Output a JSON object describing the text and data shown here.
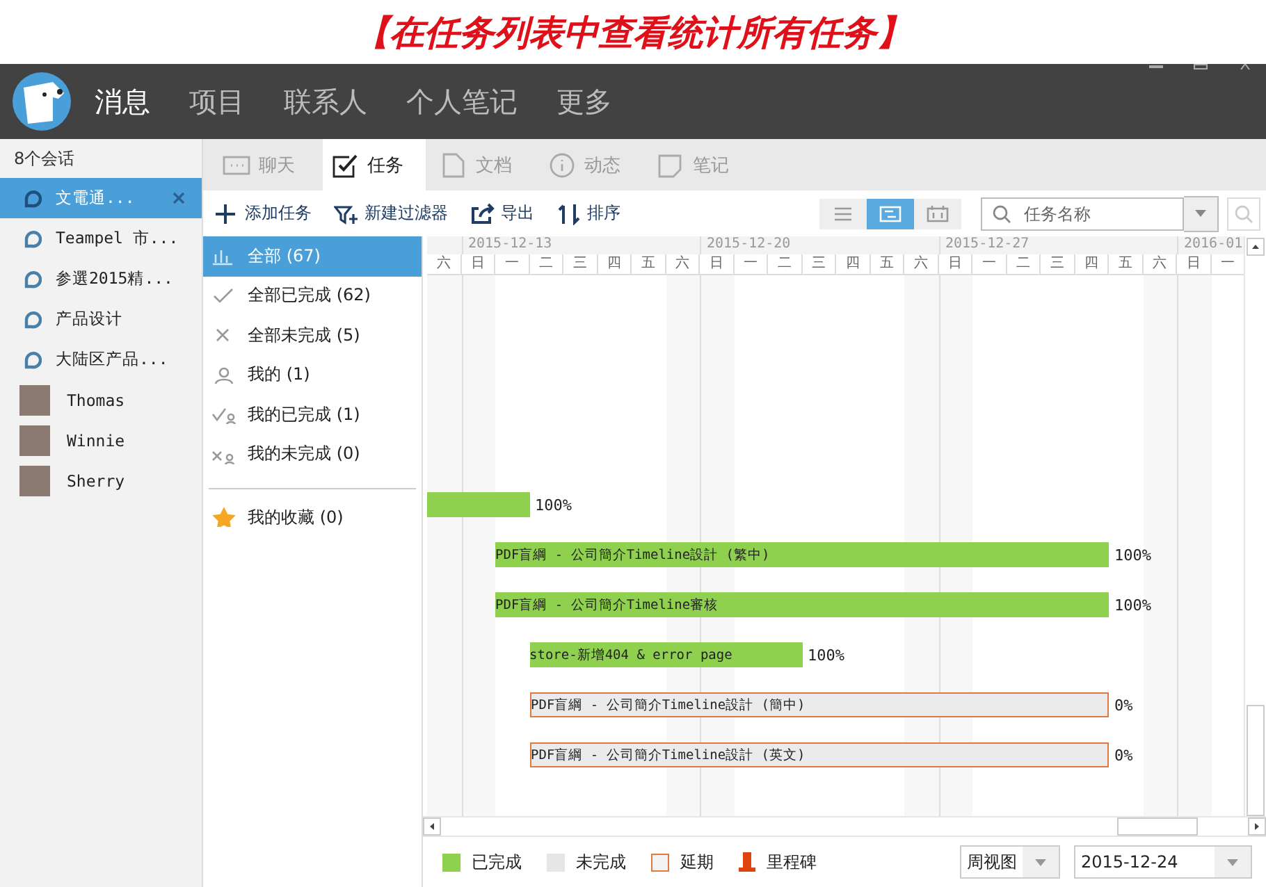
{
  "caption": "【在任务列表中查看统计所有任务】",
  "nav": [
    {
      "label": "消息",
      "selected": true
    },
    {
      "label": "项目",
      "selected": false
    },
    {
      "label": "联系人",
      "selected": false
    },
    {
      "label": "个人笔记",
      "selected": false
    },
    {
      "label": "更多",
      "selected": false
    }
  ],
  "sidebar": {
    "title": "8个会话",
    "items": [
      {
        "kind": "group",
        "label": "文電通...",
        "selected": true
      },
      {
        "kind": "group",
        "label": "Teampel 市...",
        "selected": false
      },
      {
        "kind": "group",
        "label": "参選2015精...",
        "selected": false
      },
      {
        "kind": "group",
        "label": "产品设计",
        "selected": false
      },
      {
        "kind": "group",
        "label": "大陆区产品...",
        "selected": false
      },
      {
        "kind": "person",
        "label": "Thomas",
        "selected": false
      },
      {
        "kind": "person",
        "label": "Winnie",
        "selected": false
      },
      {
        "kind": "person",
        "label": "Sherry",
        "selected": false
      }
    ]
  },
  "tabs": [
    {
      "kind": "chat",
      "label": "聊天",
      "selected": false
    },
    {
      "kind": "task",
      "label": "任务",
      "selected": true
    },
    {
      "kind": "doc",
      "label": "文档",
      "selected": false
    },
    {
      "kind": "info",
      "label": "动态",
      "selected": false
    },
    {
      "kind": "note",
      "label": "笔记",
      "selected": false
    }
  ],
  "toolbar": [
    {
      "kind": "add",
      "label": "添加任务"
    },
    {
      "kind": "filter",
      "label": "新建过滤器"
    },
    {
      "kind": "export",
      "label": "导出"
    },
    {
      "kind": "sort",
      "label": "排序"
    }
  ],
  "views": [
    {
      "kind": "list",
      "selected": false
    },
    {
      "kind": "gantt",
      "selected": true
    },
    {
      "kind": "calendar",
      "selected": false
    }
  ],
  "search": {
    "placeholder": "任务名称"
  },
  "filters": [
    {
      "kind": "all",
      "label": "全部 (67)",
      "selected": true
    },
    {
      "kind": "done",
      "label": "全部已完成 (62)",
      "selected": false
    },
    {
      "kind": "undone",
      "label": "全部未完成 (5)",
      "selected": false
    },
    {
      "kind": "mine",
      "label": "我的 (1)",
      "selected": false
    },
    {
      "kind": "mine-done",
      "label": "我的已完成 (1)",
      "selected": false
    },
    {
      "kind": "mine-undone",
      "label": "我的未完成 (0)",
      "selected": false
    },
    {
      "kind": "favorite",
      "label": "我的收藏 (0)",
      "selected": false
    }
  ],
  "gantt": {
    "weeks": [
      "2015-12-13",
      "2015-12-20",
      "2015-12-27",
      "2016-01"
    ],
    "days": [
      "六",
      "日",
      "一",
      "二",
      "三",
      "四",
      "五",
      "六",
      "日",
      "一",
      "二",
      "三",
      "四",
      "五",
      "六",
      "日",
      "一",
      "二",
      "三",
      "四",
      "五",
      "六",
      "日",
      "一"
    ],
    "tasks": [
      {
        "kind": "done",
        "delayed": false,
        "percent": "100%"
      },
      {
        "kind": "done",
        "delayed": false,
        "label": "PDF盲綱 - 公司簡介Timeline設計 (繁中)",
        "percent": "100%"
      },
      {
        "kind": "done",
        "delayed": false,
        "label": "PDF盲綱 - 公司簡介Timeline審核",
        "percent": "100%"
      },
      {
        "kind": "done",
        "delayed": false,
        "label": "store-新增404 & error page",
        "percent": "100%"
      },
      {
        "kind": "pending",
        "delayed": true,
        "label": "PDF盲綱 - 公司簡介Timeline設計 (簡中)",
        "percent": "0%"
      },
      {
        "kind": "pending",
        "delayed": true,
        "label": "PDF盲綱 - 公司簡介Timeline設計 (英文)",
        "percent": "0%"
      }
    ]
  },
  "legend": [
    {
      "kind": "done",
      "label": "已完成"
    },
    {
      "kind": "pending",
      "label": "未完成"
    },
    {
      "kind": "delayed",
      "label": "延期"
    },
    {
      "kind": "milestone",
      "label": "里程碑"
    }
  ],
  "view_select": {
    "value": "周视图"
  },
  "date_select": {
    "value": "2015-12-24"
  }
}
